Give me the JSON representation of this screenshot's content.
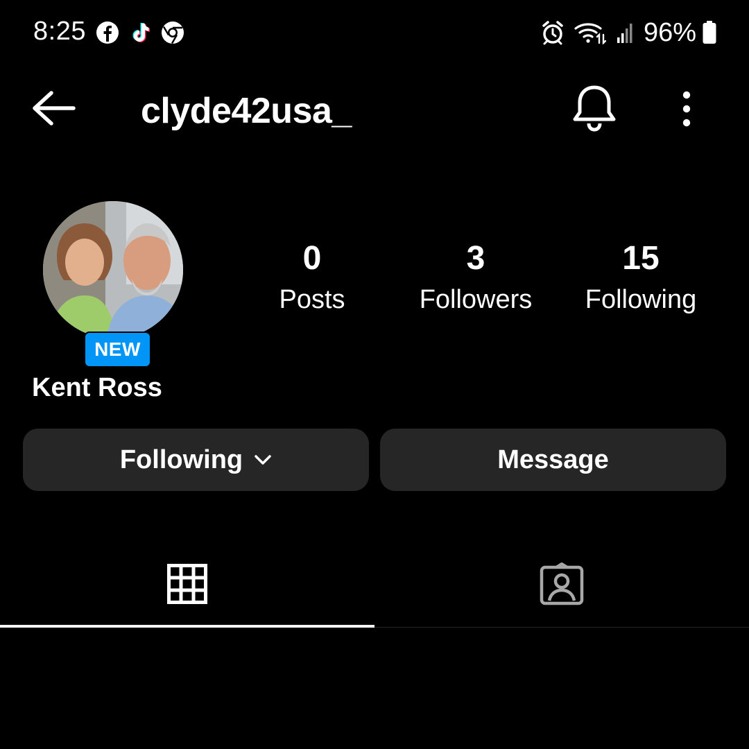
{
  "status_bar": {
    "time": "8:25",
    "battery": "96%",
    "app_icons": [
      "facebook-icon",
      "tiktok-icon",
      "chrome-icon"
    ],
    "system_icons": [
      "alarm-icon",
      "wifi-icon",
      "signal-icon",
      "battery-icon"
    ]
  },
  "nav": {
    "username": "clyde42usa_",
    "back_icon": "arrow-left-icon",
    "bell_icon": "bell-icon",
    "more_icon": "more-vertical-icon"
  },
  "profile": {
    "badge": "NEW",
    "display_name": "Kent Ross",
    "stats": {
      "posts": {
        "count": "0",
        "label": "Posts"
      },
      "followers": {
        "count": "3",
        "label": "Followers"
      },
      "following": {
        "count": "15",
        "label": "Following"
      }
    }
  },
  "actions": {
    "following_label": "Following",
    "message_label": "Message"
  },
  "tabs": {
    "active": "grid",
    "items": [
      "grid-icon",
      "tagged-icon"
    ]
  },
  "colors": {
    "background": "#000000",
    "button_bg": "#262626",
    "badge_bg": "#0095f6",
    "text": "#ffffff"
  }
}
